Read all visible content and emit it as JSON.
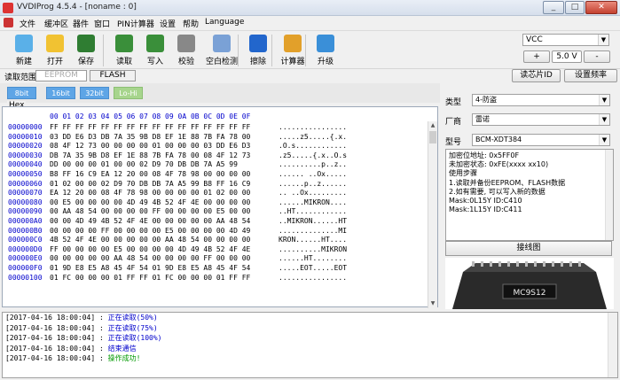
{
  "window": {
    "title": "VVDIProg 4.5.4 - [noname : 0]",
    "min_label": "_",
    "max_label": "□",
    "close_label": "✕"
  },
  "menu": [
    "文件",
    "缓冲区",
    "器件",
    "窗口",
    "PIN计算器",
    "设置",
    "帮助",
    "Language"
  ],
  "toolbar": {
    "buttons": [
      {
        "label": "新建",
        "icon": "new-file-icon"
      },
      {
        "label": "打开",
        "icon": "folder-icon"
      },
      {
        "label": "保存",
        "icon": "save-icon"
      },
      {
        "label": "读取",
        "icon": "read-chip-icon"
      },
      {
        "label": "写入",
        "icon": "write-chip-icon"
      },
      {
        "label": "校验",
        "icon": "verify-icon"
      },
      {
        "label": "空白检测",
        "icon": "blank-check-icon"
      },
      {
        "label": "擦除",
        "icon": "erase-icon"
      },
      {
        "label": "计算器",
        "icon": "calculator-icon"
      },
      {
        "label": "升级",
        "icon": "upgrade-arrow-icon"
      }
    ],
    "power_select": "VCC",
    "plus_label": "+",
    "voltage": "5.0 V",
    "minus_label": "-"
  },
  "range": {
    "label": "读取范围",
    "eeprom_tab": "EEPROM",
    "flash_tab": "FLASH",
    "read_chip_id": "读芯片ID",
    "set_frequency": "设置频率"
  },
  "bit_buttons": [
    "8bit",
    "16bit",
    "32bit",
    "Lo-Hi"
  ],
  "hex": {
    "legend": "Hex",
    "columns": [
      "00",
      "01",
      "02",
      "03",
      "04",
      "05",
      "06",
      "07",
      "08",
      "09",
      "0A",
      "0B",
      "0C",
      "0D",
      "0E",
      "0F"
    ],
    "rows": [
      {
        "addr": "00000000",
        "hex": "FF FF FF FF FF FF FF FF FF FF FF FF FF FF FF FF",
        "ascii": "................"
      },
      {
        "addr": "00000010",
        "hex": "03 DD E6 D3 DB 7A 35 9B D8 EF 1E 88 7B FA 78 00",
        "ascii": ".....z5.....{.x."
      },
      {
        "addr": "00000020",
        "hex": "08 4F 12 73 00 00 00 00 01 00 00 00 03 DD E6 D3",
        "ascii": ".O.s............"
      },
      {
        "addr": "00000030",
        "hex": "DB 7A 35 9B D8 EF 1E 88 7B FA 78 00 08 4F 12 73",
        "ascii": ".z5.....{.x..O.s"
      },
      {
        "addr": "00000040",
        "hex": "DD 00 00 00 01 00 00 02 D9 70 DB DB 7A A5 99",
        "ascii": "..........p..z.."
      },
      {
        "addr": "00000050",
        "hex": "B8 FF 16 C9 EA 12 20 00 08 4F 78 98 00 00 00 00",
        "ascii": "...... ..Ox....."
      },
      {
        "addr": "00000060",
        "hex": "01 02 00 00 02 D9 70 DB DB 7A A5 99 B8 FF 16 C9",
        "ascii": "......p..z......"
      },
      {
        "addr": "00000070",
        "hex": "EA 12 20 00 08 4F 78 98 00 00 00 00 01 02 00 00",
        "ascii": ".. ..Ox........."
      },
      {
        "addr": "00000080",
        "hex": "00 E5 00 00 00 00 4D 49 4B 52 4F 4E 00 00 00 00",
        "ascii": "......MIKRON...."
      },
      {
        "addr": "00000090",
        "hex": "00 AA 48 54 00 00 00 00 FF 00 00 00 00 E5 00 00",
        "ascii": "..HT............"
      },
      {
        "addr": "000000A0",
        "hex": "00 00 4D 49 4B 52 4F 4E 00 00 00 00 00 AA 48 54",
        "ascii": "..MIKRON......HT"
      },
      {
        "addr": "000000B0",
        "hex": "00 00 00 00 FF 00 00 00 00 E5 00 00 00 00 4D 49",
        "ascii": "..............MI"
      },
      {
        "addr": "000000C0",
        "hex": "4B 52 4F 4E 00 00 00 00 00 AA 48 54 00 00 00 00",
        "ascii": "KRON......HT...."
      },
      {
        "addr": "000000D0",
        "hex": "FF 00 00 00 00 E5 00 00 00 00 4D 49 4B 52 4F 4E",
        "ascii": "..........MIKRON"
      },
      {
        "addr": "000000E0",
        "hex": "00 00 00 00 00 AA 48 54 00 00 00 00 FF 00 00 00",
        "ascii": "......HT........"
      },
      {
        "addr": "000000F0",
        "hex": "01 9D E8 E5 A8 45 4F 54 01 9D E8 E5 A8 45 4F 54",
        "ascii": ".....EOT.....EOT"
      },
      {
        "addr": "00000100",
        "hex": "01 FC 00 00 00 01 FF FF 01 FC 00 00 00 01 FF FF",
        "ascii": "................"
      }
    ]
  },
  "device": {
    "type_label": "类型",
    "type_value": "4-防盗",
    "brand_label": "厂商",
    "brand_value": "雷诺",
    "model_label": "型号",
    "model_value": "BCM-XDT384",
    "info_lines": [
      "加密位地址: 0x5FF0F",
      "未加密状态: 0xFE(xxxx xx10)",
      "使用步骤",
      "1.读取并备份EEPROM、FLASH数据",
      "2.如有需要, 可以写入新的数据",
      "Mask:0L15Y ID:C410",
      "Mask:1L15Y ID:C411"
    ],
    "wiring_button": "接线图",
    "chip_text": "MC9S12"
  },
  "log": [
    {
      "time": "[2017-04-16 18:00:04] : ",
      "msg": "正在读取(50%)",
      "color": "#0000cc"
    },
    {
      "time": "[2017-04-16 18:00:04] : ",
      "msg": "正在读取(75%)",
      "color": "#0000cc"
    },
    {
      "time": "[2017-04-16 18:00:04] : ",
      "msg": "正在读取(100%)",
      "color": "#0000cc"
    },
    {
      "time": "[2017-04-16 18:00:04] : ",
      "msg": "结束通信",
      "color": "#0000cc"
    },
    {
      "time": "[2017-04-16 18:00:04] : ",
      "msg": "操作成功!",
      "color": "#009900"
    }
  ]
}
